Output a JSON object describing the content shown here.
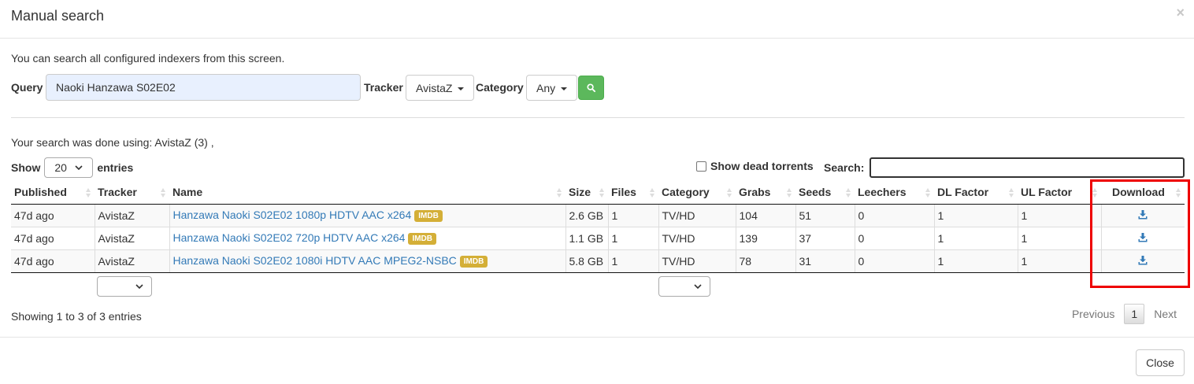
{
  "modal": {
    "title": "Manual search",
    "close_symbol": "×"
  },
  "intro": "You can search all configured indexers from this screen.",
  "search": {
    "query_label": "Query",
    "query_value": "Naoki Hanzawa S02E02",
    "tracker_label": "Tracker",
    "tracker_value": "AvistaZ",
    "category_label": "Category",
    "category_value": "Any",
    "button_icon": "search-icon"
  },
  "done_text": "Your search was done using: AvistaZ (3) ,",
  "length": {
    "show_label": "Show",
    "value": "20",
    "entries_label": "entries"
  },
  "dead_torrents_label": "Show dead torrents",
  "search_label": "Search:",
  "table": {
    "headers": {
      "published": "Published",
      "tracker": "Tracker",
      "name": "Name",
      "size": "Size",
      "files": "Files",
      "category": "Category",
      "grabs": "Grabs",
      "seeds": "Seeds",
      "leechers": "Leechers",
      "dl_factor": "DL Factor",
      "ul_factor": "UL Factor",
      "download": "Download"
    },
    "imdb_badge": "IMDB",
    "rows": [
      {
        "published": "47d ago",
        "tracker": "AvistaZ",
        "name": "Hanzawa Naoki S02E02 1080p HDTV AAC x264",
        "size": "2.6 GB",
        "files": "1",
        "category": "TV/HD",
        "grabs": "104",
        "seeds": "51",
        "leechers": "0",
        "dl_factor": "1",
        "ul_factor": "1"
      },
      {
        "published": "47d ago",
        "tracker": "AvistaZ",
        "name": "Hanzawa Naoki S02E02 720p HDTV AAC x264",
        "size": "1.1 GB",
        "files": "1",
        "category": "TV/HD",
        "grabs": "139",
        "seeds": "37",
        "leechers": "0",
        "dl_factor": "1",
        "ul_factor": "1"
      },
      {
        "published": "47d ago",
        "tracker": "AvistaZ",
        "name": "Hanzawa Naoki S02E02 1080i HDTV AAC MPEG2-NSBC",
        "size": "5.8 GB",
        "files": "1",
        "category": "TV/HD",
        "grabs": "78",
        "seeds": "31",
        "leechers": "0",
        "dl_factor": "1",
        "ul_factor": "1"
      }
    ]
  },
  "info": "Showing 1 to 3 of 3 entries",
  "pagination": {
    "previous": "Previous",
    "current": "1",
    "next": "Next"
  },
  "footer": {
    "close_label": "Close"
  },
  "colors": {
    "link": "#337ab7",
    "imdb": "#d4af37",
    "search_button": "#5cb85c",
    "highlight": "#e00000"
  }
}
